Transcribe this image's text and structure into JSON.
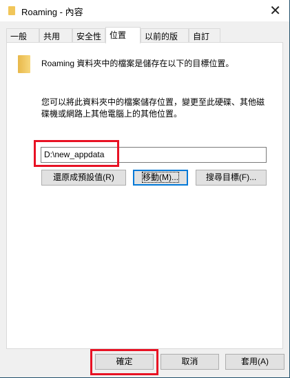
{
  "window": {
    "title": "Roaming - 內容",
    "close": "✕"
  },
  "tabs": [
    {
      "label": "一般"
    },
    {
      "label": "共用"
    },
    {
      "label": "安全性"
    },
    {
      "label": "位置",
      "active": true
    },
    {
      "label": "以前的版本"
    },
    {
      "label": "自訂"
    }
  ],
  "location": {
    "heading": "Roaming 資料夾中的檔案是儲存在以下的目標位置。",
    "description_line1": "您可以將此資料夾中的檔案儲存位置，變更至此硬碟、其他磁",
    "description_line2": "碟機或網路上其他電腦上的其他位置。",
    "path_value": "D:\\new_appdata",
    "restore_default": "還原成預設值(R)",
    "move": "移動(M)...",
    "find_target": "搜尋目標(F)..."
  },
  "footer": {
    "ok": "確定",
    "cancel": "取消",
    "apply": "套用(A)"
  },
  "colors": {
    "highlight": "#e81123",
    "focus": "#0078d7"
  }
}
